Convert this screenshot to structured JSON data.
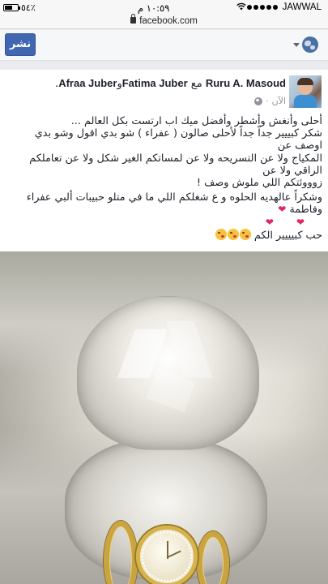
{
  "status_bar": {
    "carrier": "JAWWAL",
    "time": "١٠:٥٩ م",
    "battery_pct": "٥٤٪",
    "battery_level": 0.54,
    "icons": [
      "signal-dots-icon",
      "wifi-icon",
      "battery-icon"
    ]
  },
  "url_bar": {
    "url": "facebook.com",
    "icon": "lock-icon"
  },
  "composer": {
    "post_label": "نشر",
    "audience_icon": "globe-icon",
    "accent": "#4267b2"
  },
  "post": {
    "author": "Ruru A. Masoud",
    "with_word": "مع",
    "tag1": "Fatima Juber",
    "and_word": "و",
    "tag2": "Afraa Juber",
    "end_dot": ".",
    "time": "الآن",
    "time_sep": "·",
    "body": {
      "line1": "أحلى وأنغش وأشطر وأفضل ميك اب ارتست بكل العالم ...",
      "line2": "شكر كبييير جداً جداً لأحلى صالون ( عفراء ) شو بدي اقول وشو بدي اوصف عن",
      "line3": "المكياج ولا عن التسريحه ولا عن لمساتكم الغير شكل ولا عن تعاملكم الراقي ولا عن",
      "line4": "زوووئتكم اللي ملوش وصف !",
      "line5": "وشكراً عالهديه الحلوه و ع شغلكم اللي ما في متلو حبيبات ألبي عفراء وفاطمة",
      "line6": "حب كبيييير الكم"
    },
    "heart_color": "#e0245e"
  },
  "photo": {
    "subject": "gold-watch-in-crystal-case"
  }
}
